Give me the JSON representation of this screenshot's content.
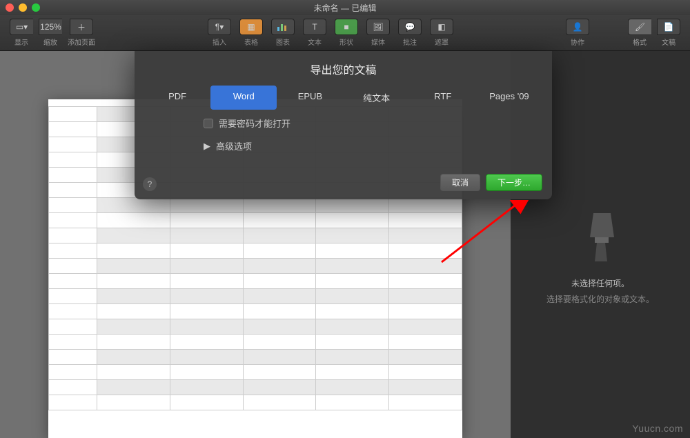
{
  "window": {
    "title": "未命名 — 已编辑"
  },
  "toolbar": {
    "view": "显示",
    "zoom_value": "125%",
    "zoom": "缩放",
    "add_page": "添加页面",
    "insert": "插入",
    "table": "表格",
    "chart": "图表",
    "text": "文本",
    "shape": "形状",
    "media": "媒体",
    "comment": "批注",
    "mask": "遮罩",
    "collab": "协作",
    "format": "格式",
    "document": "文稿"
  },
  "dialog": {
    "title": "导出您的文稿",
    "tabs": {
      "pdf": "PDF",
      "word": "Word",
      "epub": "EPUB",
      "plain": "纯文本",
      "rtf": "RTF",
      "pages09": "Pages '09"
    },
    "require_password": "需要密码才能打开",
    "advanced": "高级选项",
    "cancel": "取消",
    "next": "下一步…",
    "help": "?"
  },
  "panel": {
    "msg1": "未选择任何项。",
    "msg2": "选择要格式化的对象或文本。"
  },
  "watermark": "Yuucn.com"
}
